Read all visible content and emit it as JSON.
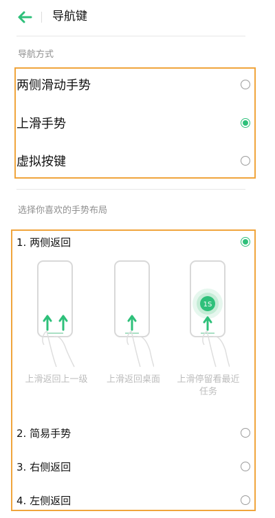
{
  "header": {
    "title": "导航键"
  },
  "nav_mode": {
    "section_label": "导航方式",
    "options": [
      {
        "label": "两侧滑动手势",
        "selected": false
      },
      {
        "label": "上滑手势",
        "selected": true
      },
      {
        "label": "虚拟按键",
        "selected": false
      }
    ]
  },
  "gesture_layout": {
    "section_label": "选择你喜欢的手势布局",
    "options": [
      {
        "label": "1. 两侧返回",
        "selected": true
      },
      {
        "label": "2. 简易手势",
        "selected": false
      },
      {
        "label": "3. 右侧返回",
        "selected": false
      },
      {
        "label": "4. 左侧返回",
        "selected": false
      }
    ],
    "illustrations": [
      {
        "caption": "上滑返回上一级"
      },
      {
        "caption": "上滑返回桌面"
      },
      {
        "caption_line1": "上滑停留看最近",
        "caption_line2": "任务",
        "hold_label": "1S"
      }
    ]
  },
  "colors": {
    "accent": "#2ec07a",
    "highlight": "#f0a43b"
  }
}
